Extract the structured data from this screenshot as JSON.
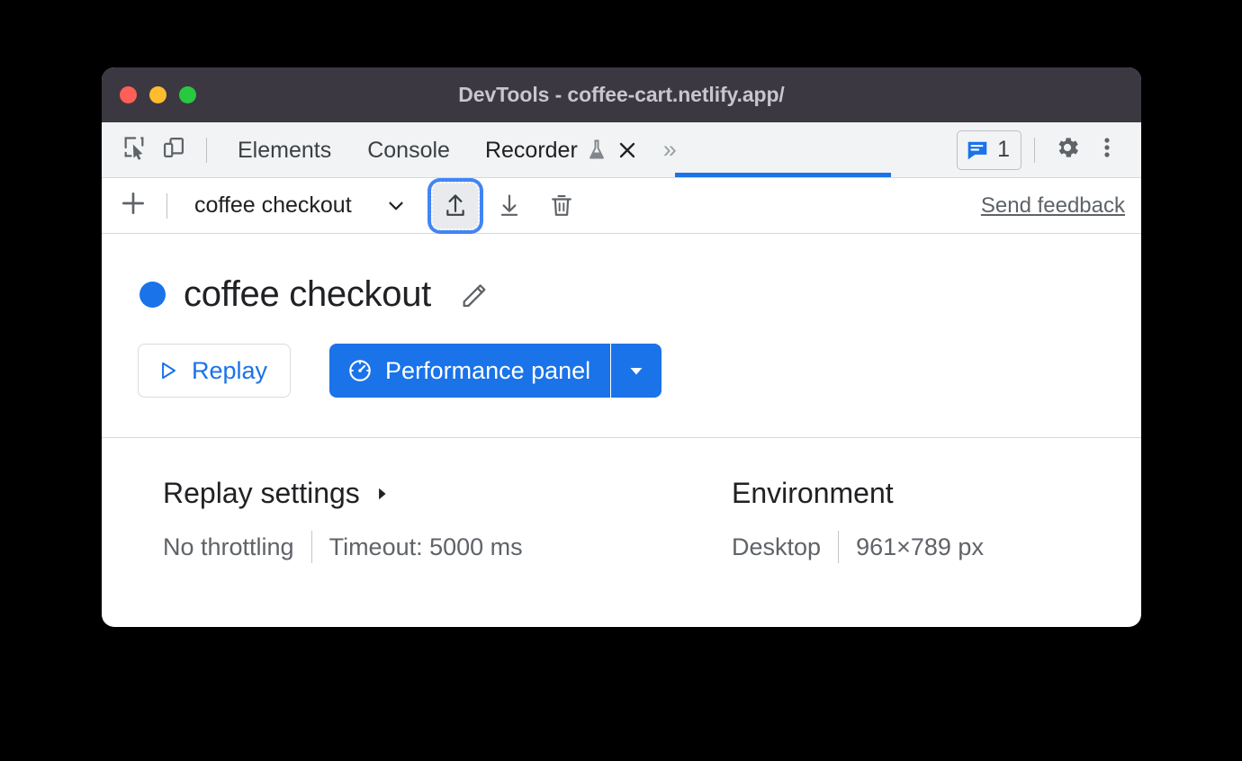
{
  "window": {
    "title": "DevTools - coffee-cart.netlify.app/",
    "traffic_lights": [
      "close-red",
      "minimize-yellow",
      "zoom-green"
    ],
    "colors": {
      "titlebar_bg": "#3c3842",
      "accent_blue": "#1a73e8",
      "focus_ring": "#4285f4",
      "tabbar_bg": "#f1f3f4",
      "divider": "#d4d4dc"
    }
  },
  "devtools_tabbar": {
    "inspect_icon": "inspect-element-icon",
    "device_toolbar_icon": "device-toolbar-icon",
    "tabs": [
      {
        "label": "Elements",
        "active": false
      },
      {
        "label": "Console",
        "active": false
      },
      {
        "label": "Recorder",
        "active": true,
        "experiment_icon": "flask-icon",
        "close_icon": "close-icon"
      }
    ],
    "more_tabs_label": "»",
    "issues": {
      "icon": "issues-message-icon",
      "count": "1"
    },
    "settings_icon": "gear-icon",
    "main_menu_icon": "three-dot-menu-icon"
  },
  "recorder_toolbar": {
    "add_icon": "plus-icon",
    "recording_name": "coffee checkout",
    "recording_dropdown_icon": "chevron-down-icon",
    "import_icon": "upload-arrow-icon",
    "export_icon": "download-arrow-icon",
    "delete_icon": "trash-icon",
    "send_feedback_label": "Send feedback"
  },
  "recording": {
    "status_dot": "recording-status-dot",
    "title": "coffee checkout",
    "edit_icon": "pencil-icon"
  },
  "actions": {
    "replay": {
      "label": "Replay",
      "icon": "play-triangle-icon"
    },
    "performance": {
      "label": "Performance panel",
      "icon": "speedometer-icon",
      "dropdown_icon": "caret-down-icon"
    }
  },
  "replay_settings": {
    "heading": "Replay settings",
    "expand_icon": "caret-right-icon",
    "throttling": "No throttling",
    "timeout": "Timeout: 5000 ms"
  },
  "environment": {
    "heading": "Environment",
    "device": "Desktop",
    "viewport": "961×789 px"
  }
}
